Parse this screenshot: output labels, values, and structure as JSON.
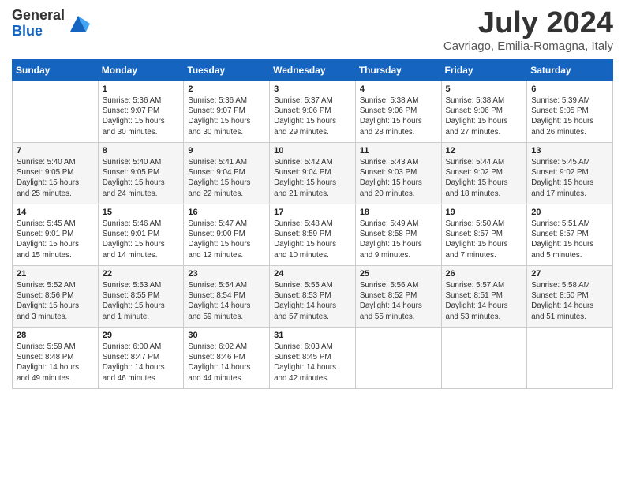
{
  "logo": {
    "general": "General",
    "blue": "Blue"
  },
  "title": "July 2024",
  "subtitle": "Cavriago, Emilia-Romagna, Italy",
  "days_of_week": [
    "Sunday",
    "Monday",
    "Tuesday",
    "Wednesday",
    "Thursday",
    "Friday",
    "Saturday"
  ],
  "weeks": [
    [
      {
        "day": "",
        "info": ""
      },
      {
        "day": "1",
        "info": "Sunrise: 5:36 AM\nSunset: 9:07 PM\nDaylight: 15 hours\nand 30 minutes."
      },
      {
        "day": "2",
        "info": "Sunrise: 5:36 AM\nSunset: 9:07 PM\nDaylight: 15 hours\nand 30 minutes."
      },
      {
        "day": "3",
        "info": "Sunrise: 5:37 AM\nSunset: 9:06 PM\nDaylight: 15 hours\nand 29 minutes."
      },
      {
        "day": "4",
        "info": "Sunrise: 5:38 AM\nSunset: 9:06 PM\nDaylight: 15 hours\nand 28 minutes."
      },
      {
        "day": "5",
        "info": "Sunrise: 5:38 AM\nSunset: 9:06 PM\nDaylight: 15 hours\nand 27 minutes."
      },
      {
        "day": "6",
        "info": "Sunrise: 5:39 AM\nSunset: 9:05 PM\nDaylight: 15 hours\nand 26 minutes."
      }
    ],
    [
      {
        "day": "7",
        "info": "Sunrise: 5:40 AM\nSunset: 9:05 PM\nDaylight: 15 hours\nand 25 minutes."
      },
      {
        "day": "8",
        "info": "Sunrise: 5:40 AM\nSunset: 9:05 PM\nDaylight: 15 hours\nand 24 minutes."
      },
      {
        "day": "9",
        "info": "Sunrise: 5:41 AM\nSunset: 9:04 PM\nDaylight: 15 hours\nand 22 minutes."
      },
      {
        "day": "10",
        "info": "Sunrise: 5:42 AM\nSunset: 9:04 PM\nDaylight: 15 hours\nand 21 minutes."
      },
      {
        "day": "11",
        "info": "Sunrise: 5:43 AM\nSunset: 9:03 PM\nDaylight: 15 hours\nand 20 minutes."
      },
      {
        "day": "12",
        "info": "Sunrise: 5:44 AM\nSunset: 9:02 PM\nDaylight: 15 hours\nand 18 minutes."
      },
      {
        "day": "13",
        "info": "Sunrise: 5:45 AM\nSunset: 9:02 PM\nDaylight: 15 hours\nand 17 minutes."
      }
    ],
    [
      {
        "day": "14",
        "info": "Sunrise: 5:45 AM\nSunset: 9:01 PM\nDaylight: 15 hours\nand 15 minutes."
      },
      {
        "day": "15",
        "info": "Sunrise: 5:46 AM\nSunset: 9:01 PM\nDaylight: 15 hours\nand 14 minutes."
      },
      {
        "day": "16",
        "info": "Sunrise: 5:47 AM\nSunset: 9:00 PM\nDaylight: 15 hours\nand 12 minutes."
      },
      {
        "day": "17",
        "info": "Sunrise: 5:48 AM\nSunset: 8:59 PM\nDaylight: 15 hours\nand 10 minutes."
      },
      {
        "day": "18",
        "info": "Sunrise: 5:49 AM\nSunset: 8:58 PM\nDaylight: 15 hours\nand 9 minutes."
      },
      {
        "day": "19",
        "info": "Sunrise: 5:50 AM\nSunset: 8:57 PM\nDaylight: 15 hours\nand 7 minutes."
      },
      {
        "day": "20",
        "info": "Sunrise: 5:51 AM\nSunset: 8:57 PM\nDaylight: 15 hours\nand 5 minutes."
      }
    ],
    [
      {
        "day": "21",
        "info": "Sunrise: 5:52 AM\nSunset: 8:56 PM\nDaylight: 15 hours\nand 3 minutes."
      },
      {
        "day": "22",
        "info": "Sunrise: 5:53 AM\nSunset: 8:55 PM\nDaylight: 15 hours\nand 1 minute."
      },
      {
        "day": "23",
        "info": "Sunrise: 5:54 AM\nSunset: 8:54 PM\nDaylight: 14 hours\nand 59 minutes."
      },
      {
        "day": "24",
        "info": "Sunrise: 5:55 AM\nSunset: 8:53 PM\nDaylight: 14 hours\nand 57 minutes."
      },
      {
        "day": "25",
        "info": "Sunrise: 5:56 AM\nSunset: 8:52 PM\nDaylight: 14 hours\nand 55 minutes."
      },
      {
        "day": "26",
        "info": "Sunrise: 5:57 AM\nSunset: 8:51 PM\nDaylight: 14 hours\nand 53 minutes."
      },
      {
        "day": "27",
        "info": "Sunrise: 5:58 AM\nSunset: 8:50 PM\nDaylight: 14 hours\nand 51 minutes."
      }
    ],
    [
      {
        "day": "28",
        "info": "Sunrise: 5:59 AM\nSunset: 8:48 PM\nDaylight: 14 hours\nand 49 minutes."
      },
      {
        "day": "29",
        "info": "Sunrise: 6:00 AM\nSunset: 8:47 PM\nDaylight: 14 hours\nand 46 minutes."
      },
      {
        "day": "30",
        "info": "Sunrise: 6:02 AM\nSunset: 8:46 PM\nDaylight: 14 hours\nand 44 minutes."
      },
      {
        "day": "31",
        "info": "Sunrise: 6:03 AM\nSunset: 8:45 PM\nDaylight: 14 hours\nand 42 minutes."
      },
      {
        "day": "",
        "info": ""
      },
      {
        "day": "",
        "info": ""
      },
      {
        "day": "",
        "info": ""
      }
    ]
  ]
}
